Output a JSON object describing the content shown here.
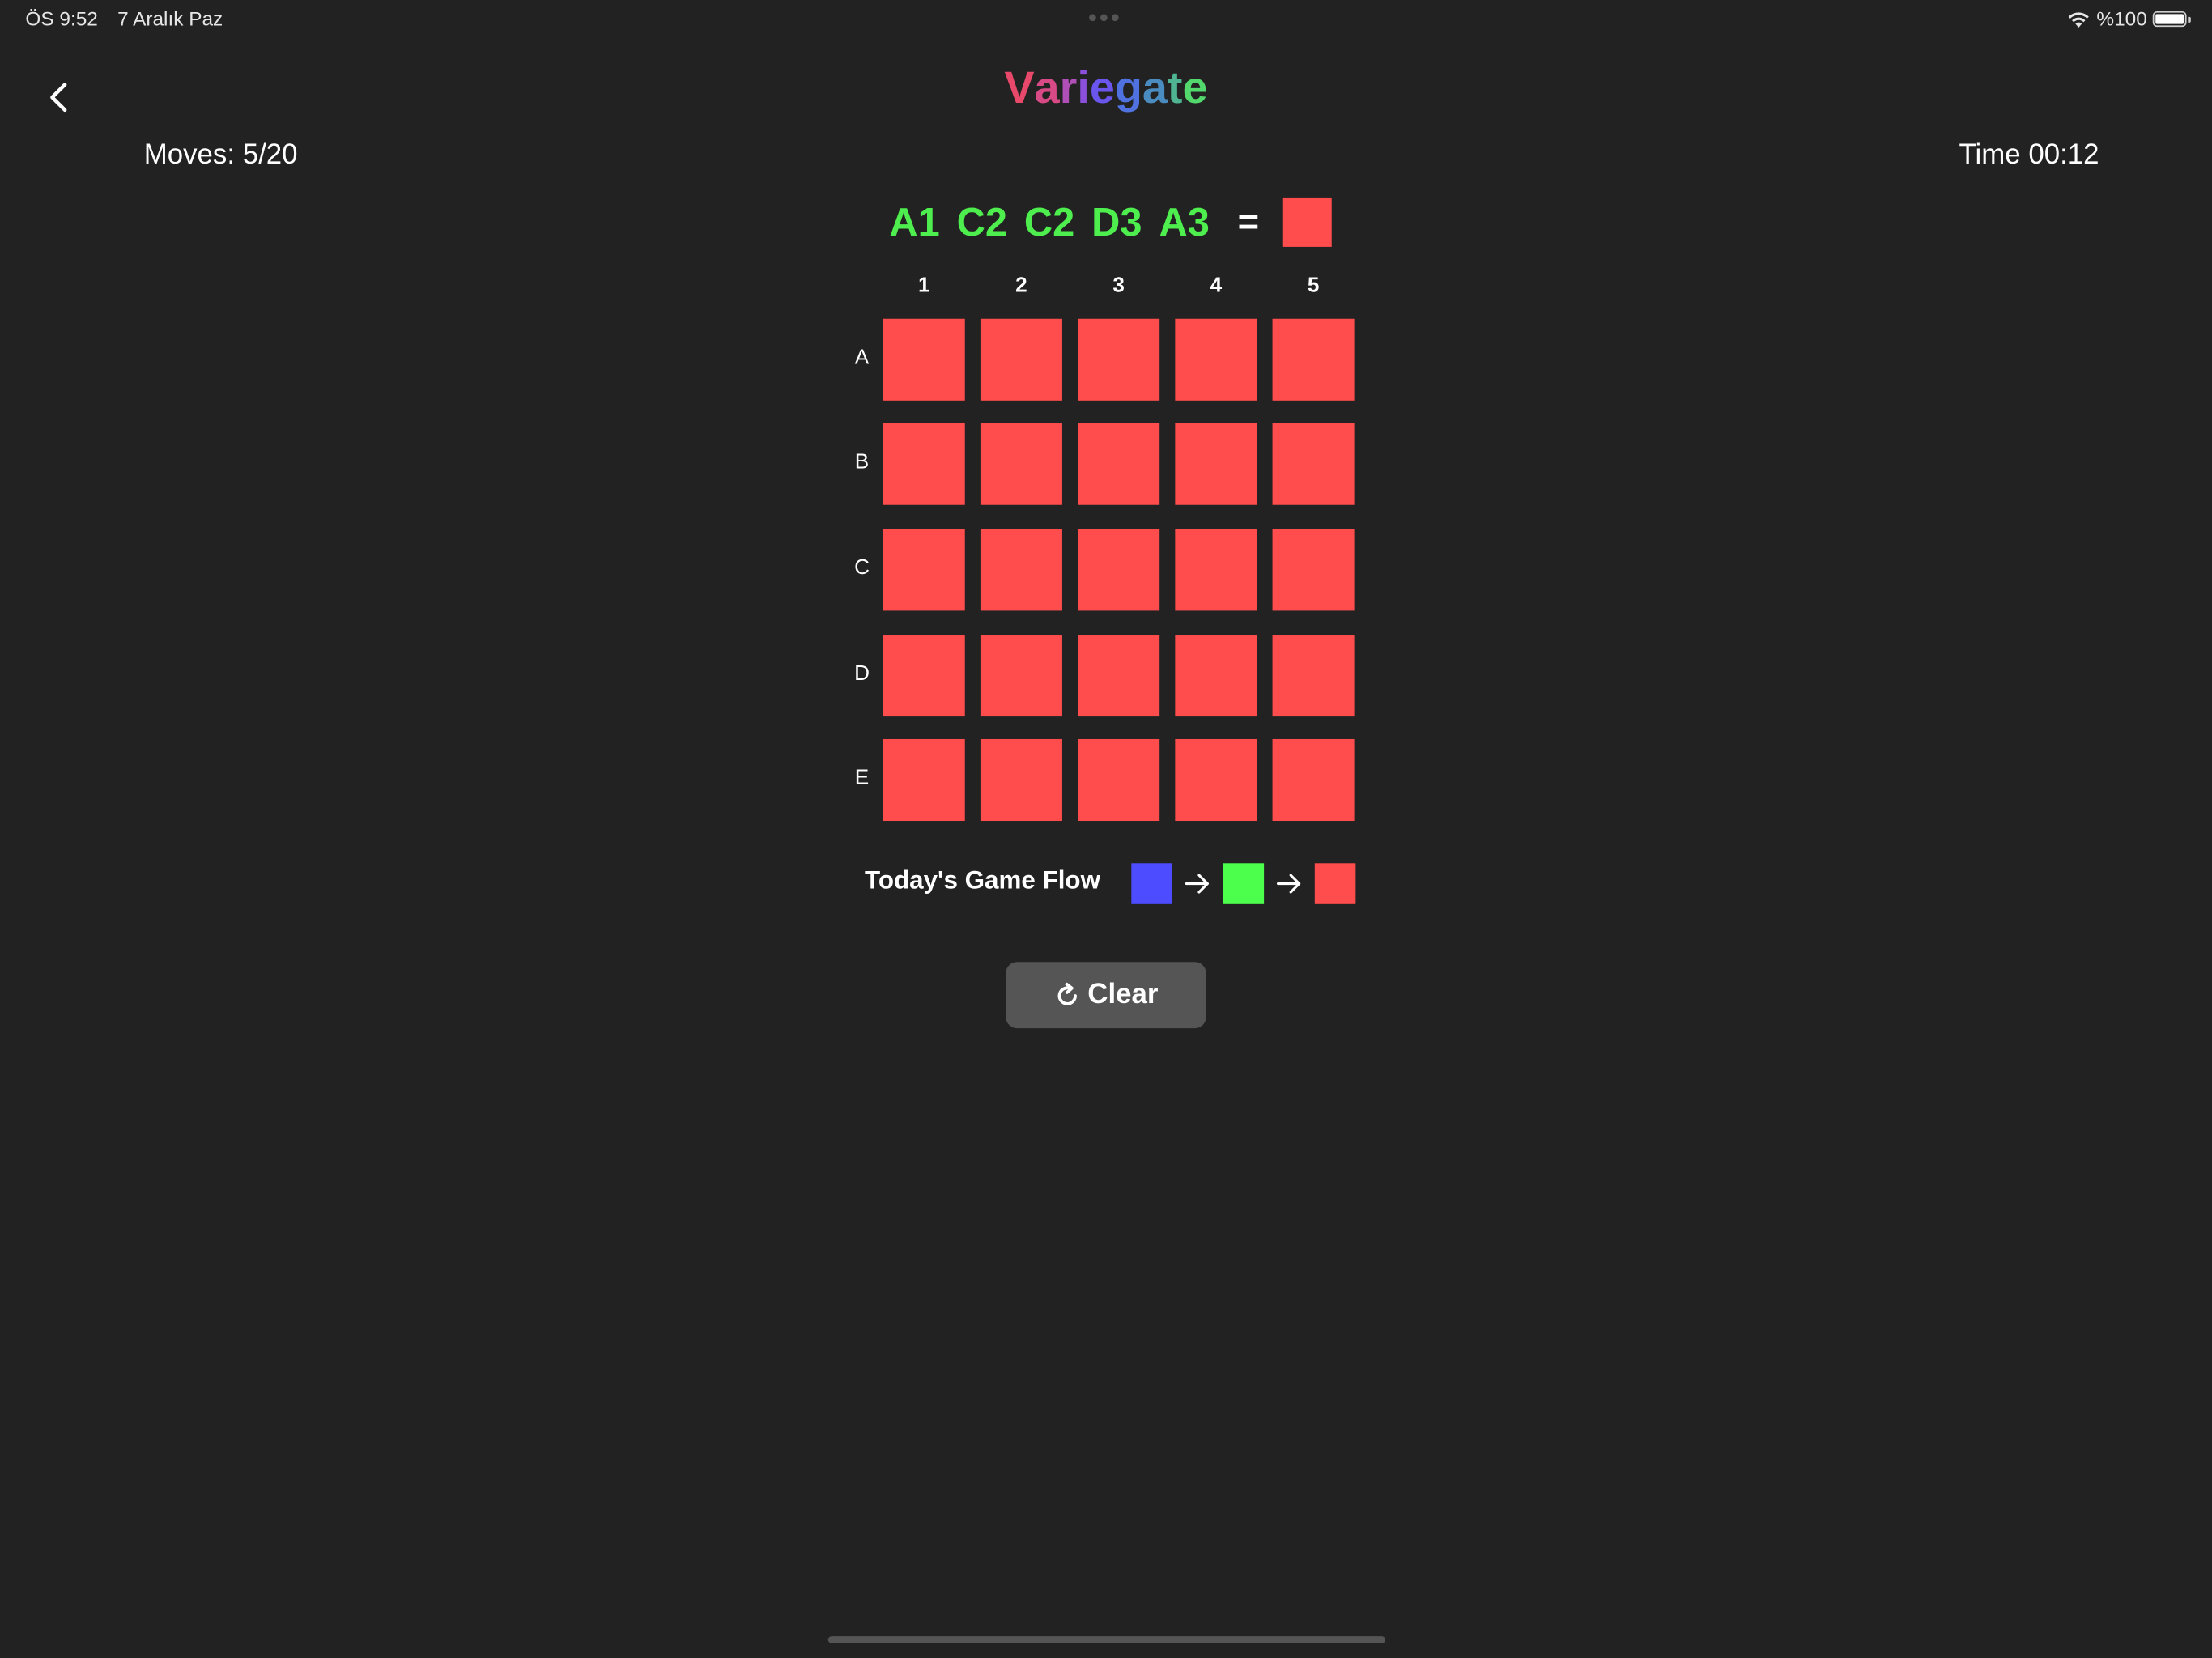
{
  "status_bar": {
    "time": "ÖS 9:52",
    "date": "7 Aralık Paz",
    "battery_text": "%100",
    "icons": [
      "wifi-icon",
      "battery-icon"
    ]
  },
  "header": {
    "title": "Variegate",
    "title_letters": [
      "V",
      "a",
      "r",
      "i",
      "e",
      "g",
      "a",
      "t",
      "e"
    ],
    "title_colors": [
      "#e8496a",
      "#d84a86",
      "#b04fb8",
      "#8a4fdb",
      "#6a56ec",
      "#4f72e0",
      "#4a8cc0",
      "#4eb492",
      "#52d86c"
    ],
    "back_icon": "chevron-left-icon"
  },
  "stats": {
    "moves": "Moves: 5/20",
    "time": "Time 00:12"
  },
  "sequence": {
    "moves": [
      "A1",
      "C2",
      "C2",
      "D3",
      "A3"
    ],
    "equals": "=",
    "target_color": "#ff4d4d",
    "move_color": "#4dee4d"
  },
  "grid": {
    "columns": [
      "1",
      "2",
      "3",
      "4",
      "5"
    ],
    "rows": [
      "A",
      "B",
      "C",
      "D",
      "E"
    ],
    "cells": [
      [
        "#ff4d4d",
        "#ff4d4d",
        "#ff4d4d",
        "#ff4d4d",
        "#ff4d4d"
      ],
      [
        "#ff4d4d",
        "#ff4d4d",
        "#ff4d4d",
        "#ff4d4d",
        "#ff4d4d"
      ],
      [
        "#ff4d4d",
        "#ff4d4d",
        "#ff4d4d",
        "#ff4d4d",
        "#ff4d4d"
      ],
      [
        "#ff4d4d",
        "#ff4d4d",
        "#ff4d4d",
        "#ff4d4d",
        "#ff4d4d"
      ],
      [
        "#ff4d4d",
        "#ff4d4d",
        "#ff4d4d",
        "#ff4d4d",
        "#ff4d4d"
      ]
    ]
  },
  "game_flow": {
    "label": "Today's Game Flow",
    "colors": [
      "#4d4dff",
      "#4dff4d",
      "#ff4d4d"
    ],
    "arrow_icon": "arrow-right-icon"
  },
  "clear_button": {
    "label": "Clear",
    "icon": "refresh-icon"
  },
  "colors": {
    "background": "#222222",
    "red": "#ff4d4d",
    "green": "#4dff4d",
    "blue": "#4d4dff",
    "button": "#555555"
  }
}
